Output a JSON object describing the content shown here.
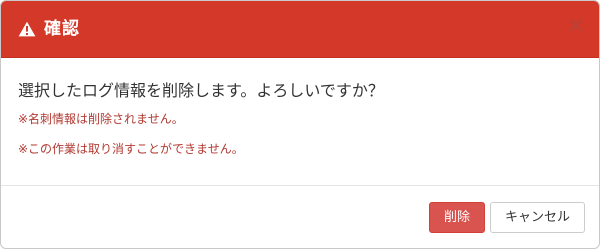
{
  "dialog": {
    "title": "確認",
    "title_icon": "warning-icon",
    "close_icon": "close-icon",
    "message": "選択したログ情報を削除します。よろしいですか？",
    "notes": [
      "※名刺情報は削除されません。",
      "※この作業は取り消すことができません。"
    ],
    "buttons": {
      "delete_label": "削除",
      "cancel_label": "キャンセル"
    },
    "colors": {
      "header_bg": "#d33828",
      "note_text": "#b23a33",
      "delete_button": "#d9534f"
    }
  }
}
